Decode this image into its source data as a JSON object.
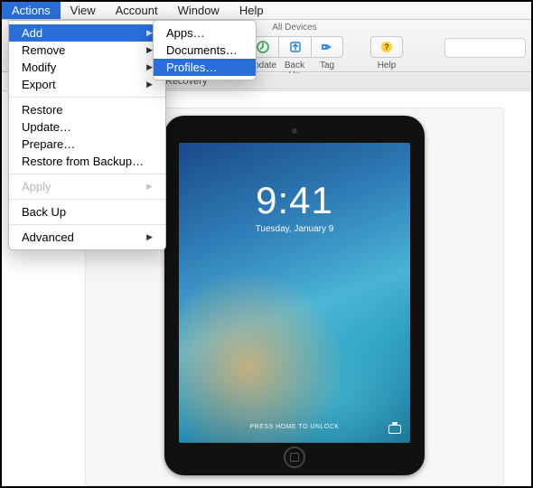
{
  "menubar": {
    "items": [
      {
        "label": "Actions",
        "open": true
      },
      {
        "label": "View"
      },
      {
        "label": "Account"
      },
      {
        "label": "Window"
      },
      {
        "label": "Help"
      }
    ]
  },
  "actions_menu": {
    "add": "Add",
    "remove": "Remove",
    "modify": "Modify",
    "export": "Export",
    "restore": "Restore",
    "update": "Update…",
    "prepare": "Prepare…",
    "restore_backup": "Restore from Backup…",
    "apply": "Apply",
    "back_up": "Back Up",
    "advanced": "Advanced"
  },
  "add_submenu": {
    "apps": "Apps…",
    "documents": "Documents…",
    "profiles": "Profiles…"
  },
  "toolbar": {
    "group_label": "All Devices",
    "update": "Update",
    "back_up": "Back Up",
    "tag": "Tag",
    "help": "Help"
  },
  "crumbs": {
    "recovery": "Recovery"
  },
  "device": {
    "time": "9:41",
    "date": "Tuesday, January 9",
    "unlock": "PRESS HOME TO UNLOCK"
  }
}
